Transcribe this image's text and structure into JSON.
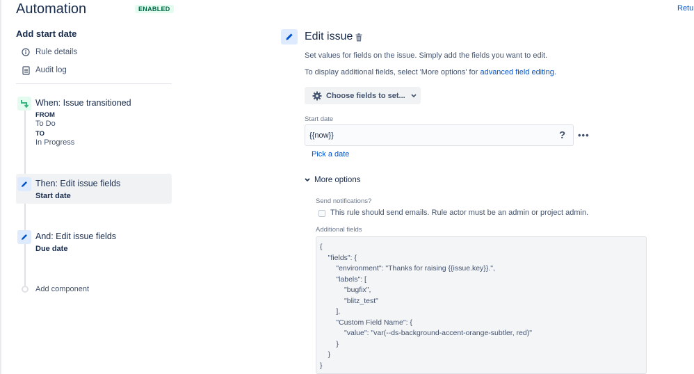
{
  "header": {
    "title": "Automation",
    "status_badge": "ENABLED",
    "return_link": "Retur"
  },
  "sidebar": {
    "rule_name": "Add start date",
    "nav": [
      {
        "label": "Rule details",
        "icon": "info-icon"
      },
      {
        "label": "Audit log",
        "icon": "audit-log-icon"
      }
    ],
    "trigger": {
      "title": "When: Issue transitioned",
      "from_label": "FROM",
      "from_value": "To Do",
      "to_label": "TO",
      "to_value": "In Progress",
      "icon": "transition-icon"
    },
    "actions": [
      {
        "title": "Then: Edit issue fields",
        "subtitle": "Start date",
        "icon": "pencil-icon"
      },
      {
        "title": "And: Edit issue fields",
        "subtitle": "Due date",
        "icon": "pencil-icon"
      }
    ],
    "add_component": "Add component"
  },
  "editor": {
    "title": "Edit issue",
    "description1": "Set values for fields on the issue. Simply add the fields you want to edit.",
    "description2_prefix": "To display additional fields, select 'More options' for ",
    "description2_link": "advanced field editing.",
    "choose_fields": "Choose fields to set...",
    "start_date_label": "Start date",
    "start_date_value": "{{now}}",
    "help_glyph": "?",
    "more_glyph": "•••",
    "pick_date": "Pick a date",
    "more_options": "More options",
    "send_notifications_label": "Send notifications?",
    "send_notifications_text": "This rule should send emails. Rule actor must be an admin or project admin.",
    "additional_fields_label": "Additional fields",
    "additional_fields_json": "{\n    \"fields\": {\n        \"environment\": \"Thanks for raising {{issue.key}}.\",\n        \"labels\": [\n            \"bugfix\",\n            \"blitz_test\"\n        ],\n        \"Custom Field Name\": {\n            \"value\": \"var(--ds-background-accent-orange-subtler, red)\"\n        }\n    }\n}"
  },
  "colors": {
    "accent": "#0052cc",
    "badge_bg": "#e3fcef",
    "badge_text": "#006644",
    "action_icon_bg": "#deebff"
  }
}
